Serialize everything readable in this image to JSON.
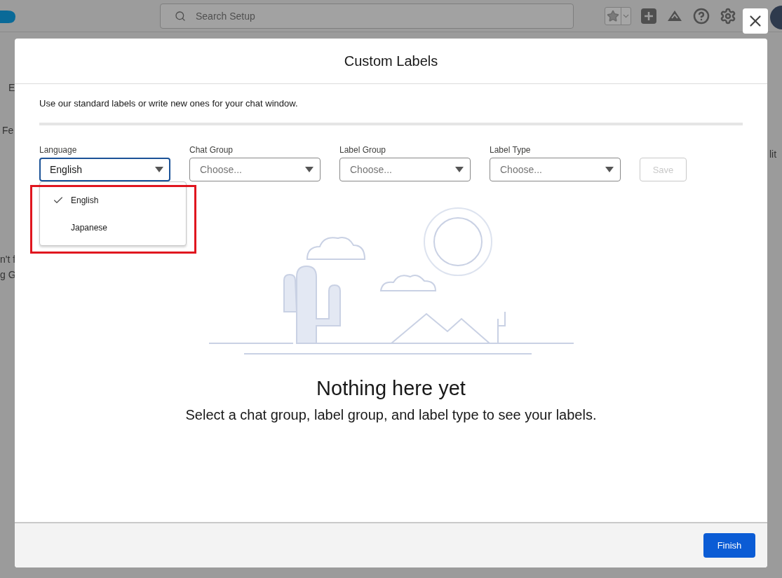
{
  "app_header": {
    "search": {
      "placeholder": "Search Setup"
    }
  },
  "background_fragments": [
    "E",
    "Fe",
    "n't f",
    "g G",
    "lit"
  ],
  "modal": {
    "title": "Custom Labels",
    "description": "Use our standard labels or write new ones for your chat window.",
    "filters": [
      {
        "label": "Language",
        "value": "English",
        "focused": true
      },
      {
        "label": "Chat Group",
        "placeholder": "Choose...",
        "focused": false
      },
      {
        "label": "Label Group",
        "placeholder": "Choose...",
        "focused": false
      },
      {
        "label": "Label Type",
        "placeholder": "Choose...",
        "focused": false
      }
    ],
    "save_button": {
      "label": "Save",
      "disabled": true
    },
    "language_menu": {
      "highlighted": true,
      "items": [
        {
          "label": "English",
          "selected": true
        },
        {
          "label": "Japanese",
          "selected": false
        }
      ]
    },
    "empty_state": {
      "title": "Nothing here yet",
      "message": "Select a chat group, label group, and label type to see your labels."
    },
    "finish_button": {
      "label": "Finish"
    }
  }
}
